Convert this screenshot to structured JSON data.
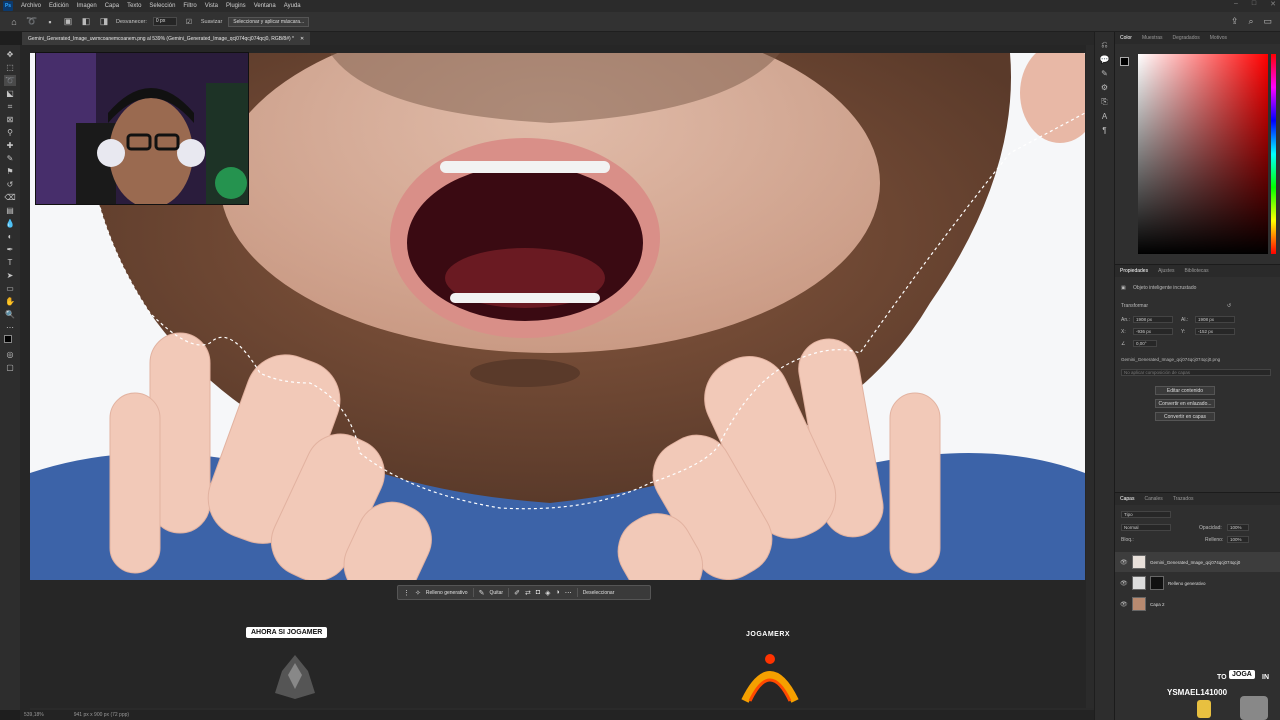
{
  "menubar": {
    "items": [
      "Archivo",
      "Edición",
      "Imagen",
      "Capa",
      "Texto",
      "Selección",
      "Filtro",
      "Vista",
      "Plugins",
      "Ventana",
      "Ayuda"
    ]
  },
  "options": {
    "feather_label": "Desvanecer:",
    "feather_value": "0 px",
    "smooth_label": "Suavizar",
    "select_mask_button": "Seleccionar y aplicar máscara..."
  },
  "document": {
    "tab_title": "Gemini_Generated_Image_uwmcoanemcoanem.png al 539% (Gemini_Generated_Image_qcj074qcj074qcj0, RGB/8#) *"
  },
  "contextbar": {
    "generative_fill": "Relleno generativo",
    "remove": "Quitar",
    "deselect": "Deseleccionar"
  },
  "status": {
    "zoom": "539,18%",
    "size": "941 px x 900 px (72 ppp)"
  },
  "color_panel": {
    "tabs": [
      "Color",
      "Muestras",
      "Degradados",
      "Motivos"
    ],
    "hue_color": "#ff0000"
  },
  "properties_panel": {
    "tabs": [
      "Propiedades",
      "Ajustes",
      "Bibliotecas"
    ],
    "object_type": "Objeto inteligente incrustado",
    "transform_label": "Transformar",
    "w": "1908 px",
    "h": "1908 px",
    "x": "-936 px",
    "y": "-152 px",
    "angle": "0,00°",
    "filename": "Gemini_Generated_Image_qcj074qcj074qcj0.png",
    "layer_comp": "No aplicar composición de capas",
    "edit_contents": "Editar contenido",
    "convert_linked": "Convertir en enlazado...",
    "convert_layers": "Convertir en capas"
  },
  "layers_panel": {
    "tabs": [
      "Capas",
      "Canales",
      "Trazados"
    ],
    "filter": "Tipo",
    "blend_mode": "Normal",
    "opacity_label": "Opacidad:",
    "opacity": "100%",
    "fill_label": "Relleno:",
    "fill": "100%",
    "lock_label": "Bloq.:",
    "layers": [
      {
        "name": "Gemini_Generated_Image_qcj074qcj074qcj0"
      },
      {
        "name": "Relleno generativo"
      },
      {
        "name": "Capa 2"
      }
    ]
  },
  "stream": {
    "left_label": "AHORA SI JOGAMER",
    "center_label": "JOGAMERX",
    "corner_label1": "TO",
    "corner_badge": "JOGA",
    "corner_label2": "IN",
    "corner_name": "YSMAEL141000"
  }
}
